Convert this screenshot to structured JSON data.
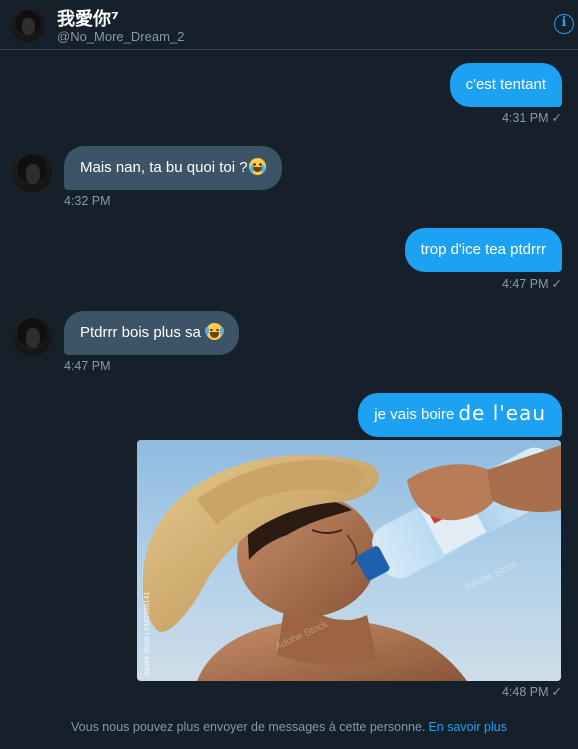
{
  "header": {
    "name": "我愛你⁷",
    "handle": "@No_More_Dream_2",
    "info_icon": "info-icon",
    "info_glyph": "i"
  },
  "messages": [
    {
      "direction": "out",
      "text": "c'est tentant",
      "time": "4:31 PM"
    },
    {
      "direction": "in",
      "text": "Mais nan, ta bu quoi toi ?",
      "emoji": "loudly-crying-face",
      "time": "4:32 PM"
    },
    {
      "direction": "out",
      "text": "trop d'ice tea ptdrrr",
      "time": "4:47 PM"
    },
    {
      "direction": "in",
      "text": "Ptdrrr bois plus sa",
      "emoji": "face-with-tears-of-joy",
      "time": "4:47 PM"
    },
    {
      "direction": "out",
      "text": "je vais boire",
      "text_large": "de l'eau",
      "time": "4:48 PM",
      "image": {
        "description_icon": "photo-man-drinking-water",
        "watermark_side": "Adobe Stock | #162898141",
        "watermark": "Adobe Stock"
      }
    }
  ],
  "check_glyph": "✓",
  "footer": {
    "notice": "Vous nous pouvez plus envoyer de messages à cette personne.",
    "link": "En savoir plus"
  },
  "colors": {
    "background": "#15202b",
    "outgoing_bubble": "#1da1f2",
    "incoming_bubble": "#3d5466",
    "muted_text": "#8899a6",
    "accent": "#1da1f2"
  }
}
